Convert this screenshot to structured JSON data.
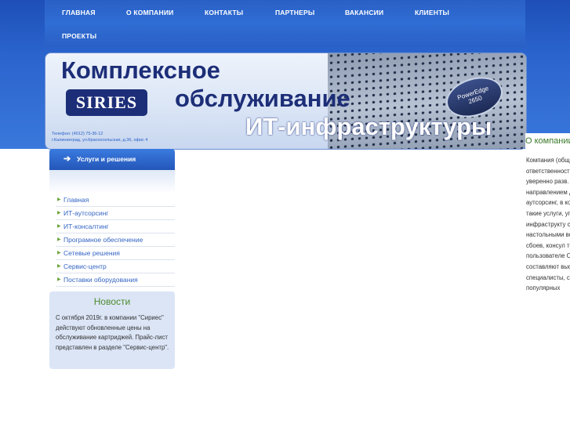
{
  "nav": {
    "items": [
      "ГЛАВНАЯ",
      "О КОМПАНИИ",
      "КОНТАКТЫ",
      "ПАРТНЕРЫ",
      "ВАКАНСИИ",
      "КЛИЕНТЫ",
      "ПРОЕКТЫ"
    ]
  },
  "banner": {
    "line1": "Комплексное",
    "line2": "обслуживание",
    "line3": "ИТ-инфраструктуры",
    "logo": "SIRIES",
    "server_badge_1": "PowerEdge",
    "server_badge_2": "2650",
    "info_line1": "Телефон: (4012) 75-36-12",
    "info_line2": "г.Калининград, ул.Красносельская, д.36, офис 4"
  },
  "sidebar": {
    "header": "Услуги и решения",
    "arrow": "➔",
    "items": [
      "Главная",
      "ИТ-аутсорсинг",
      "ИТ-консалтинг",
      "Програмное обеспечение",
      "Сетевые решения",
      "Сервис-центр",
      "Поставки оборудования"
    ],
    "bullet": "▶"
  },
  "news": {
    "title": "Новости",
    "text": "С октября 2019г. в компании \"Сириес\" действуют обновленные цены на обслуживание картриджей. Прайс-лист представлен в разделе \"Сервис-центр\"."
  },
  "right": {
    "title": "О компании",
    "text": "Компания (общество с ответственностью \"СИРИЕС\") уверенно разв. ИТ-компания. направлением деятельности аутсорсинг, в которого мы п такие услуги, управление се инфраструкту серверным обо и настольными восстановлен сбоев, консул техническая п пользователе Основу комп составляют высококвалиф специалисты, сертификацию популярных"
  }
}
